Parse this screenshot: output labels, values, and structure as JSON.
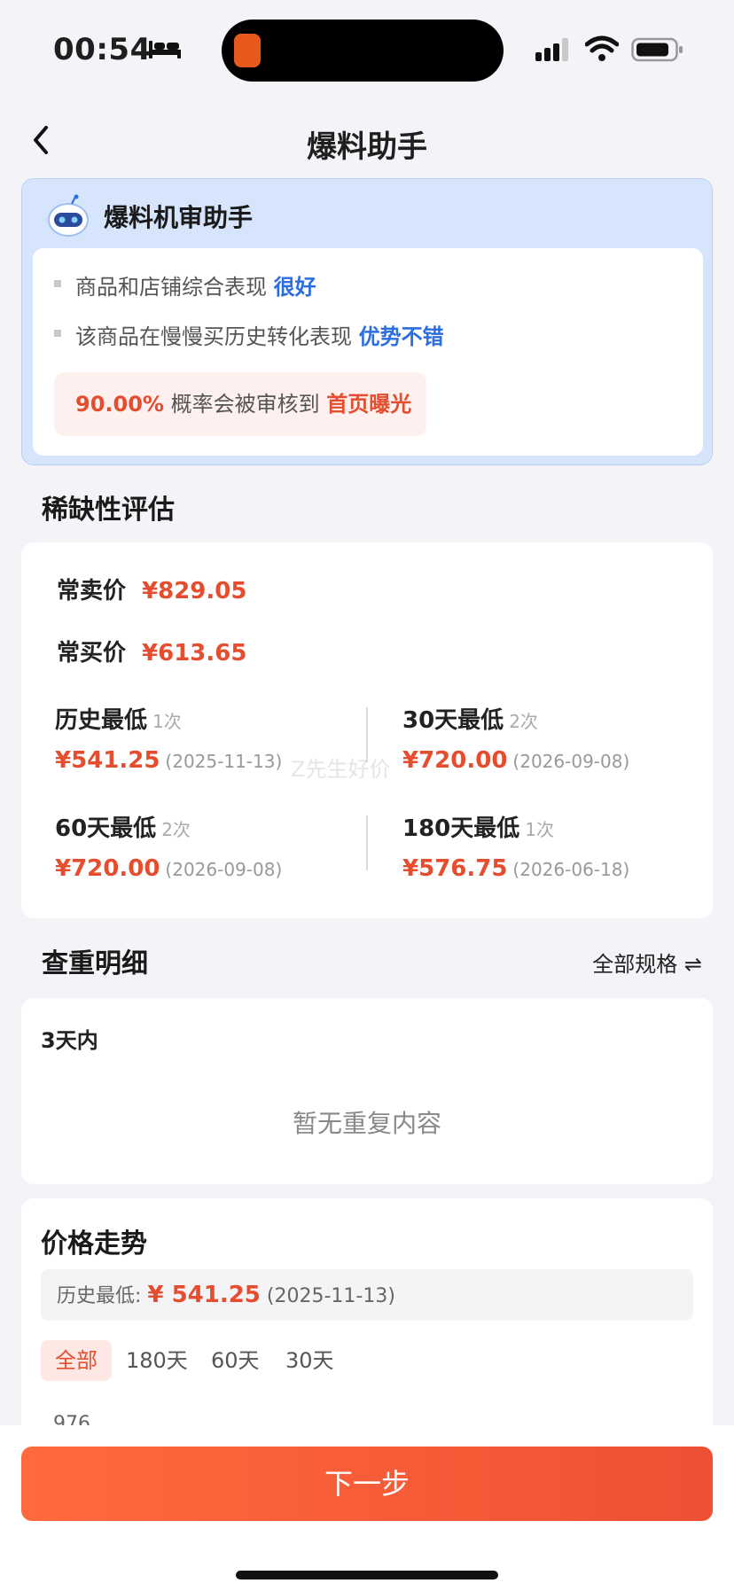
{
  "status": {
    "time": "00:54"
  },
  "nav": {
    "title": "爆料助手"
  },
  "robot": {
    "title": "爆料机审助手",
    "bullets": [
      {
        "text": "商品和店铺综合表现",
        "highlight": "很好"
      },
      {
        "text": "该商品在慢慢买历史转化表现",
        "highlight": "优势不错"
      }
    ],
    "probability": "90.00%",
    "probability_text": "概率会被审核到",
    "probability_target": "首页曝光"
  },
  "scarcity": {
    "title": "稀缺性评估",
    "regular_sell_label": "常卖价",
    "regular_sell_value": "¥829.05",
    "regular_buy_label": "常买价",
    "regular_buy_value": "¥613.65",
    "lows": [
      {
        "label": "历史最低",
        "count": "1次",
        "price": "¥541.25",
        "date": "(2025-11-13)"
      },
      {
        "label": "30天最低",
        "count": "2次",
        "price": "¥720.00",
        "date": "(2026-09-08)"
      },
      {
        "label": "60天最低",
        "count": "2次",
        "price": "¥720.00",
        "date": "(2026-09-08)"
      },
      {
        "label": "180天最低",
        "count": "1次",
        "price": "¥576.75",
        "date": "(2026-06-18)"
      }
    ],
    "watermark": "Z先生好价"
  },
  "duplicate": {
    "title": "查重明细",
    "spec_switch": "全部规格 ⇌",
    "period": "3天内",
    "empty": "暂无重复内容"
  },
  "trend": {
    "title": "价格走势",
    "hist_label": "历史最低:",
    "hist_price": "¥ 541.25",
    "hist_date": "(2025-11-13)",
    "tabs": [
      "全部",
      "180天",
      "60天",
      "30天"
    ],
    "active_tab": 0,
    "y_top_label": "976"
  },
  "footer": {
    "next_label": "下一步"
  },
  "colors": {
    "accent_red": "#e54d2e",
    "accent_blue": "#2c6ee0",
    "button": "#ee5033"
  }
}
